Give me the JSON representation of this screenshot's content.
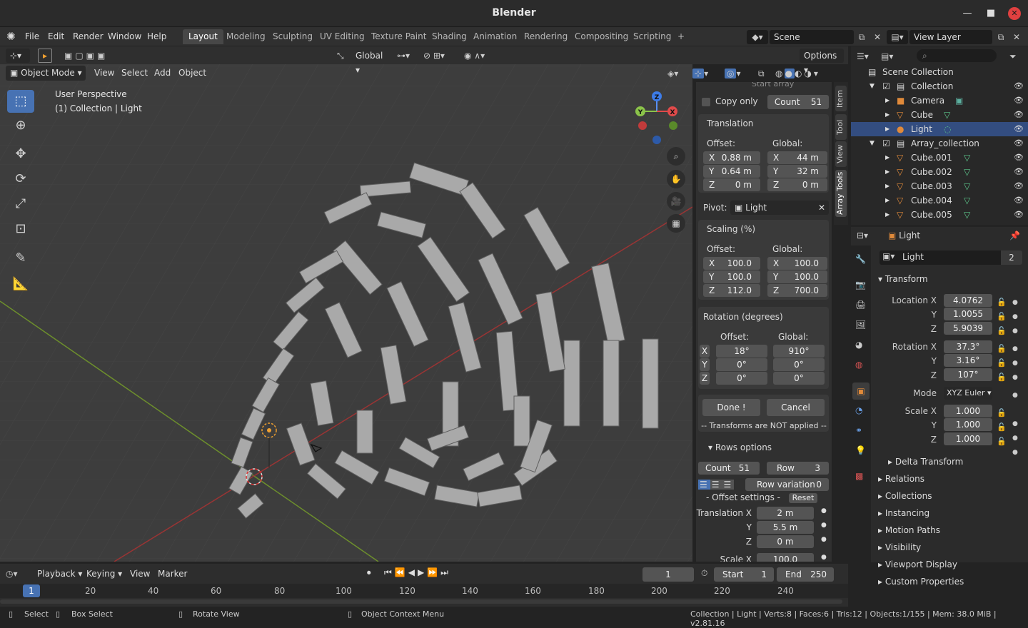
{
  "window": {
    "title": "Blender"
  },
  "menu": [
    "File",
    "Edit",
    "Render",
    "Window",
    "Help"
  ],
  "workspaces": [
    "Layout",
    "Modeling",
    "Sculpting",
    "UV Editing",
    "Texture Paint",
    "Shading",
    "Animation",
    "Rendering",
    "Compositing",
    "Scripting"
  ],
  "scene": {
    "name": "Scene",
    "view_layer": "View Layer"
  },
  "viewport_header": {
    "transform": "Global",
    "options": "Options",
    "mode": "Object Mode",
    "menus": [
      "View",
      "Select",
      "Add",
      "Object"
    ]
  },
  "viewport_overlay": {
    "perspective": "User Perspective",
    "collection": "(1) Collection | Light"
  },
  "array_panel": {
    "start_label": "Start array",
    "copy_only": "Copy only",
    "count_label": "Count",
    "count": "51",
    "translation_title": "Translation",
    "offset_label": "Offset:",
    "global_label": "Global:",
    "t_offset": {
      "x": "0.88 m",
      "y": "0.64 m",
      "z": "0 m"
    },
    "t_global": {
      "x": "44 m",
      "y": "32 m",
      "z": "0 m"
    },
    "pivot_label": "Pivot:",
    "pivot": "Light",
    "scaling_title": "Scaling (%)",
    "s_offset": {
      "x": "100.0",
      "y": "100.0",
      "z": "112.0"
    },
    "s_global": {
      "x": "100.0",
      "y": "100.0",
      "z": "700.0"
    },
    "rotation_title": "Rotation (degrees)",
    "r_offset": {
      "x": "18°",
      "y": "0°",
      "z": "0°"
    },
    "r_global": {
      "x": "910°",
      "y": "0°",
      "z": "0°"
    },
    "done": "Done !",
    "cancel": "Cancel",
    "note": "-- Transforms are NOT applied --",
    "rows_title": "Rows options",
    "rows_count_label": "Count",
    "rows_count": "51",
    "row_label": "Row",
    "row": "3",
    "row_variation": "Row variation",
    "row_variation_val": "0",
    "offset_settings": "- Offset settings -",
    "reset": "Reset",
    "translation_x_label": "Translation X",
    "tx": "2 m",
    "ty": "5.5 m",
    "tz": "0 m",
    "scale_x_label": "Scale X",
    "sx": "100.0"
  },
  "side_tabs": [
    "Item",
    "Tool",
    "View",
    "Array Tools"
  ],
  "outliner": {
    "items": [
      {
        "label": "Scene Collection"
      },
      {
        "label": "Collection"
      },
      {
        "label": "Camera"
      },
      {
        "label": "Cube"
      },
      {
        "label": "Light"
      },
      {
        "label": "Array_collection"
      },
      {
        "label": "Cube.001"
      },
      {
        "label": "Cube.002"
      },
      {
        "label": "Cube.003"
      },
      {
        "label": "Cube.004"
      },
      {
        "label": "Cube.005"
      }
    ]
  },
  "properties": {
    "object": "Light",
    "data_name": "Light",
    "users": "2",
    "transform_title": "Transform",
    "location_label": "Location X",
    "loc": {
      "x": "4.0762",
      "y": "1.0055",
      "z": "5.9039"
    },
    "rotation_label": "Rotation X",
    "rot": {
      "x": "37.3°",
      "y": "3.16°",
      "z": "107°"
    },
    "mode_label": "Mode",
    "mode": "XYZ Euler",
    "scale_label": "Scale X",
    "scale": {
      "x": "1.000",
      "y": "1.000",
      "z": "1.000"
    },
    "sections": [
      "Delta Transform",
      "Relations",
      "Collections",
      "Instancing",
      "Motion Paths",
      "Visibility",
      "Viewport Display",
      "Custom Properties"
    ]
  },
  "timeline": {
    "menus": [
      "Playback",
      "Keying",
      "View",
      "Marker"
    ],
    "current": "1",
    "start_label": "Start",
    "start": "1",
    "end_label": "End",
    "end": "250",
    "ticks": [
      "1",
      "20",
      "40",
      "60",
      "80",
      "100",
      "120",
      "140",
      "160",
      "180",
      "200",
      "220",
      "240"
    ]
  },
  "statusbar": {
    "select": "Select",
    "box_select": "Box Select",
    "rotate": "Rotate View",
    "context": "Object Context Menu",
    "stats": "Collection | Light | Verts:8 | Faces:6 | Tris:12 | Objects:1/155 | Mem: 38.0 MiB | v2.81.16"
  },
  "colors": {
    "accent": "#4772b3",
    "selected_row": "#334d80"
  }
}
